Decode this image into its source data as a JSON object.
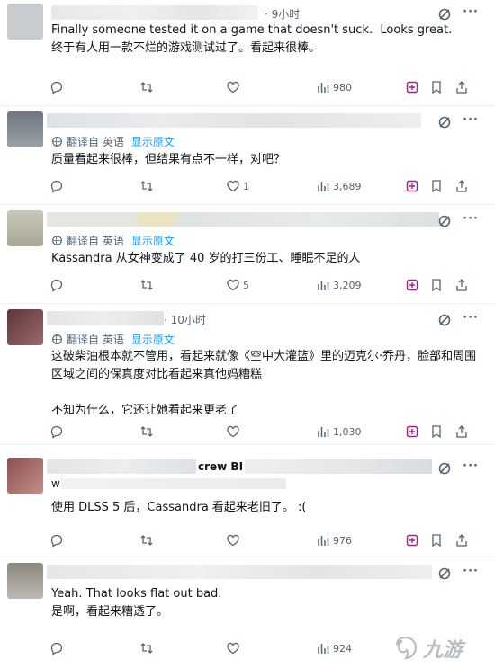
{
  "posts": [
    {
      "time": "· 9小时",
      "handle": "",
      "show_translate": false,
      "translate_label": "",
      "show_original": "",
      "text": "Finally someone tested it on a game that doesn't suck.  Looks great.\n终于有人用一款不烂的游戏测试过了。看起来很棒。",
      "replies": "",
      "reposts": "",
      "likes": "",
      "views": "980",
      "avatar_color": "#c8cccf"
    },
    {
      "time": "",
      "handle": "",
      "show_translate": true,
      "translate_label": "翻译自 英语",
      "show_original": "显示原文",
      "text": "质量看起来很棒，但结果有点不一样，对吧？",
      "replies": "",
      "reposts": "",
      "likes": "1",
      "views": "3,689",
      "avatar_color": "#8a8f98"
    },
    {
      "time": "",
      "handle": "",
      "show_translate": true,
      "translate_label": "翻译自 英语",
      "show_original": "显示原文",
      "text": "Kassandra 从女神变成了 40 岁的打三份工、睡眠不足的人",
      "replies": "",
      "reposts": "",
      "likes": "5",
      "views": "3,209",
      "avatar_color": "#b9b6a8"
    },
    {
      "time": "· 10小时",
      "handle": "",
      "show_translate": true,
      "translate_label": "翻译自 英语",
      "show_original": "显示原文",
      "text": "这破柴油根本就不管用，看起来就像《空中大灌篮》里的迈克尔·乔丹，脸部和周围区域之间的保真度对比看起来真他妈糟糕\n\n不知为什么，它还让她看起来更老了",
      "replies": "",
      "reposts": "",
      "likes": "",
      "views": "1,030",
      "avatar_color": "#7a4a4e"
    },
    {
      "time": "",
      "handle": "crew BI",
      "handle2": "w",
      "show_translate": false,
      "translate_label": "",
      "show_original": "",
      "text": "使用 DLSS 5 后，Cassandra 看起来老旧了。 :(",
      "replies": "",
      "reposts": "",
      "likes": "",
      "views": "976",
      "avatar_color": "#a86e6e"
    },
    {
      "time": "",
      "handle": "",
      "show_translate": false,
      "translate_label": "",
      "show_original": "",
      "text": "Yeah. That looks flat out bad.\n是啊，看起来糟透了。",
      "replies": "",
      "reposts": "",
      "likes": "",
      "views": "924",
      "avatar_color": "#a8a09a"
    }
  ],
  "icons": {
    "reply": "reply-icon",
    "repost": "repost-icon",
    "like": "like-icon",
    "views": "views-icon",
    "bookmark": "bookmark-icon",
    "share": "share-icon",
    "grok": "grok-icon",
    "more": "more-icon",
    "translate": "translate-icon"
  },
  "colors": {
    "link": "#1d9bf0",
    "muted": "#536471",
    "accent_icon": "#a0208c"
  },
  "watermark": {
    "text": "九游"
  }
}
